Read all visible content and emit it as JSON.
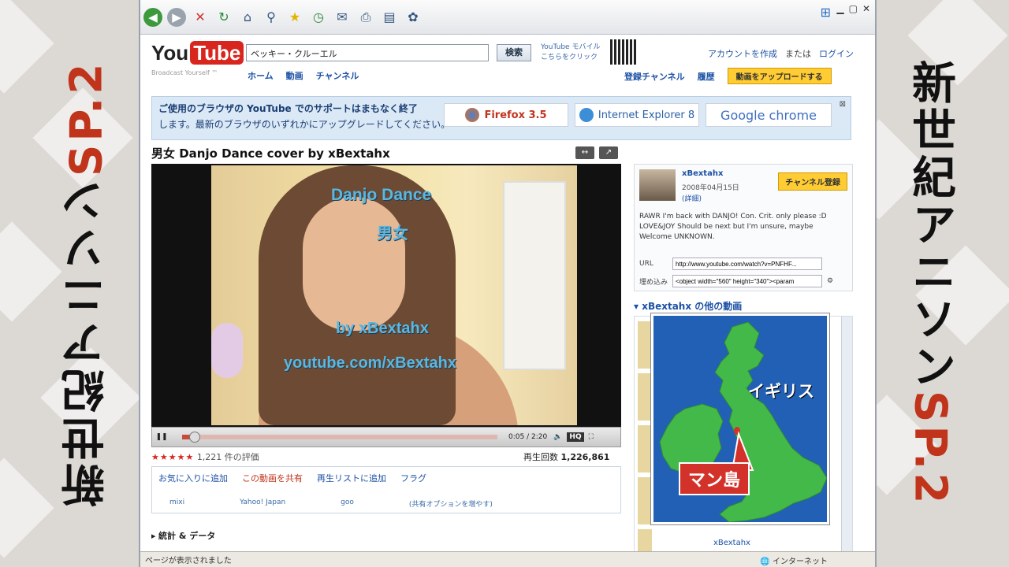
{
  "side_title": {
    "kanji": "新世紀アニソン",
    "sp": "SP.2"
  },
  "browser": {
    "status_text": "ページが表示されました",
    "zone_text": "インターネット"
  },
  "youtube": {
    "logo_you": "You",
    "logo_tube": "Tube",
    "tagline": "Broadcast Yourself ™",
    "search_value": "ベッキー・クルーエル",
    "search_button": "検索",
    "mobile_line1": "YouTube モバイル",
    "mobile_line2": "こちらをクリック",
    "nav": [
      "ホーム",
      "動画",
      "チャンネル"
    ],
    "account": {
      "create": "アカウントを作成",
      "or": "または",
      "login": "ログイン"
    },
    "subnav": {
      "subs": "登録チャンネル",
      "history": "履歴",
      "upload": "動画をアップロードする"
    }
  },
  "banner": {
    "line1": "ご使用のブラウザの YouTube でのサポートはまもなく終了",
    "line2": "します。最新のブラウザのいずれかにアップグレードしてください。",
    "browsers": [
      "Firefox 3.5",
      "Internet Explorer 8",
      "Google chrome"
    ],
    "close": "⊠"
  },
  "video": {
    "title": "男女 Danjo Dance cover by xBextahx",
    "overlay": {
      "l1": "Danjo Dance",
      "l2": "男女",
      "l3": "by xBextahx",
      "l4": "youtube.com/xBextahx"
    },
    "time": "0:05 / 2:20",
    "progress": 0.04,
    "hq": "HQ",
    "rating_count": "1,221 件の評価",
    "views_label": "再生回数",
    "views": "1,226,861",
    "actions": [
      "お気に入りに追加",
      "この動画を共有",
      "再生リストに追加",
      "フラグ"
    ],
    "shares": [
      "mixi",
      "Yahoo! Japan",
      "goo",
      "(共有オプションを増やす)"
    ],
    "stats": "統計 & データ"
  },
  "channel": {
    "name": "xBextahx",
    "date": "2008年04月15日",
    "more": "(詳細)",
    "subscribe": "チャンネル登録",
    "description": "RAWR I'm back with DANJO! Con. Crit. only please :D LOVE&JOY Should be next but I'm unsure, maybe Welcome UNKNOWN.",
    "url_label": "URL",
    "url_value": "http://www.youtube.com/watch?v=PNFHF...",
    "embed_label": "埋め込み",
    "embed_value": "<object width=\"560\" height=\"340\"><param",
    "others_title": "xBextahx の他の動画",
    "others_item_author": "xBextahx"
  },
  "map_overlay": {
    "uk_label": "イギリス",
    "isle_label": "マン島",
    "colors": {
      "sea": "#2260b5",
      "land": "#43b94a",
      "tag": "#d2322a"
    }
  }
}
